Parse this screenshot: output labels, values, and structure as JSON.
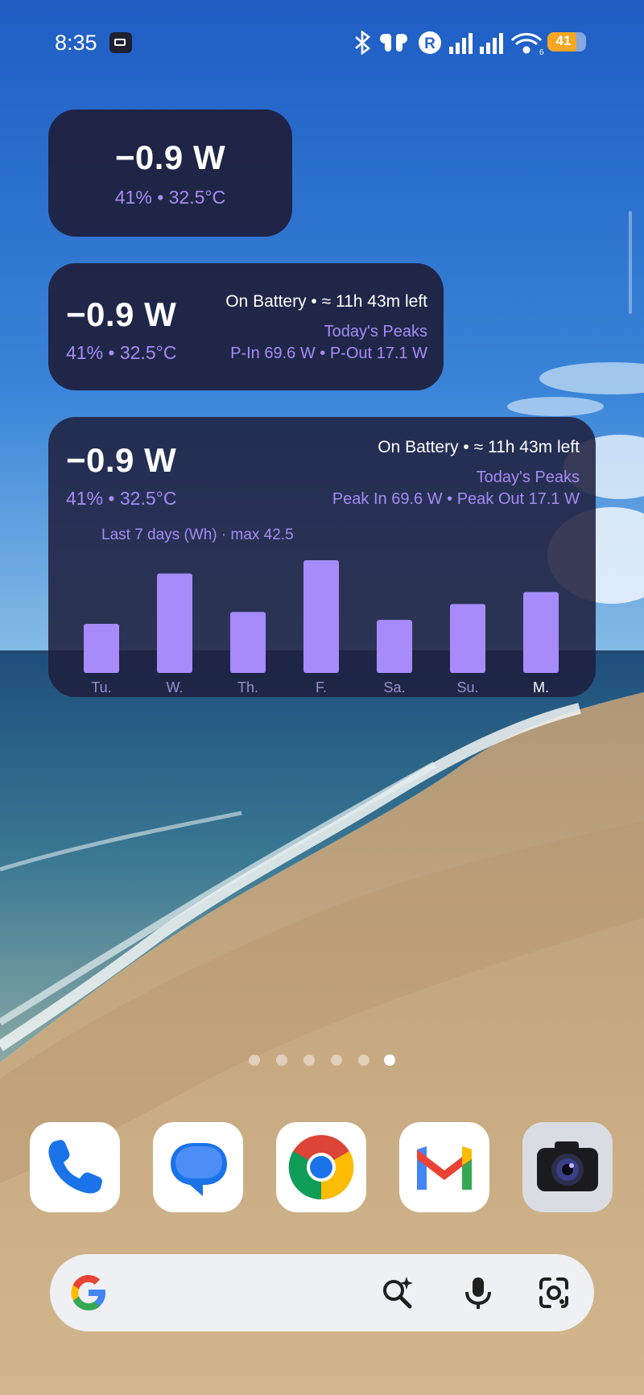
{
  "status_bar": {
    "time": "8:35",
    "battery_level": "41",
    "icons": [
      "notification-battery-app-icon",
      "bluetooth-icon",
      "earbuds-icon",
      "roaming-r-icon",
      "signal-icon",
      "signal-icon",
      "wifi-6-icon",
      "battery-icon"
    ]
  },
  "widget_small": {
    "power": "−0.9 W",
    "details": "41% • 32.5°C"
  },
  "widget_medium": {
    "power": "−0.9 W",
    "details": "41% • 32.5°C",
    "status": "On Battery • ≈ 11h 43m left",
    "peaks_title": "Today's Peaks",
    "peaks": "P-In 69.6 W • P-Out 17.1 W"
  },
  "widget_large": {
    "power": "−0.9 W",
    "details": "41% • 32.5°C",
    "status": "On Battery • ≈ 11h 43m left",
    "peaks_title": "Today's Peaks",
    "peaks": "Peak In 69.6 W • Peak Out 17.1 W",
    "chart_caption": "Last 7 days (Wh) · max 42.5"
  },
  "chart_data": {
    "type": "bar",
    "title": "Last 7 days (Wh) · max 42.5",
    "categories": [
      "Tu.",
      "W.",
      "Th.",
      "F.",
      "Sa.",
      "Su.",
      "M."
    ],
    "values": [
      18.5,
      37.5,
      23.0,
      42.5,
      20.0,
      26.0,
      30.5
    ],
    "ylim": [
      0,
      42.5
    ],
    "bar_color": "#a78bfa"
  },
  "page_indicator": {
    "count": 6,
    "active": 6
  },
  "dock": [
    "phone-app-icon",
    "messages-app-icon",
    "chrome-app-icon",
    "gmail-app-icon",
    "camera-app-icon"
  ],
  "search_bar": {
    "icons": [
      "google-logo-icon",
      "search-sparkle-icon",
      "microphone-icon",
      "lens-icon"
    ]
  },
  "colors": {
    "widget_bg": "#1e1e3c",
    "accent": "#a58cf3",
    "battery_fill": "#f5a623"
  }
}
